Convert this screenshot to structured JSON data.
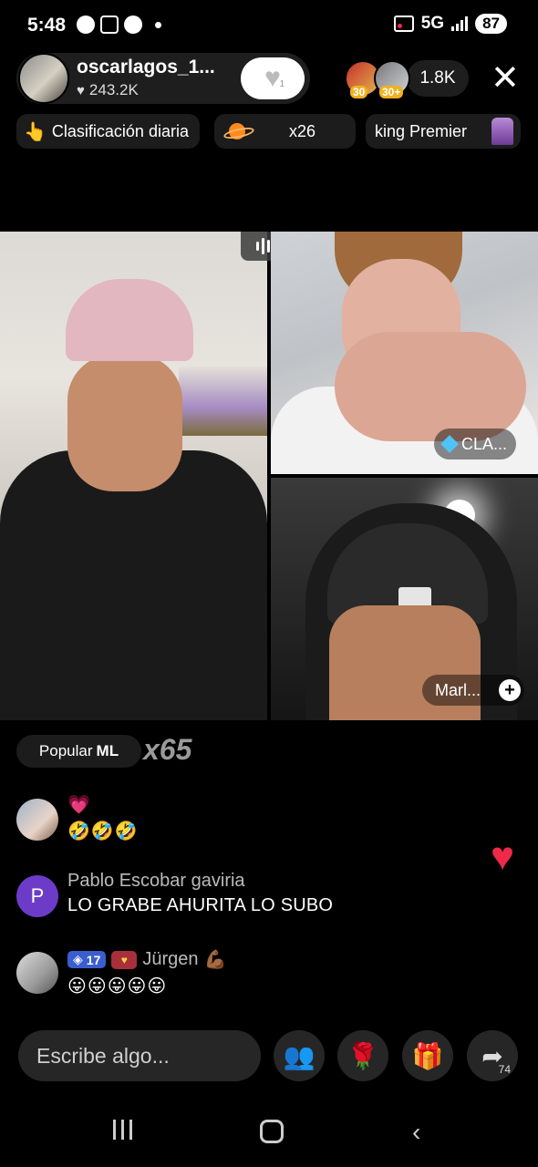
{
  "status_bar": {
    "time": "5:48",
    "network": "5G",
    "battery": "87"
  },
  "host": {
    "name": "oscarlagos_1...",
    "likes": "243.2K",
    "like_count": "1"
  },
  "viewers": {
    "levels": [
      "30",
      "30+"
    ],
    "count": "1.8K"
  },
  "pills": {
    "daily_ranking": "Clasificación diaria",
    "gift_count": "x26",
    "king": "king Premier"
  },
  "guests": {
    "guest1_name": "CLA...",
    "guest2_name": "Marl..."
  },
  "popular": {
    "label": "Popular",
    "region": "ML",
    "multiplier": "x65"
  },
  "comments": [
    {
      "author": "",
      "text": "🤣🤣🤣",
      "top_emoji": "💗"
    },
    {
      "author": "Pablo Escobar gaviria",
      "initial": "P",
      "text": "LO GRABE AHURITA LO SUBO"
    },
    {
      "author": "Jürgen",
      "level": "17",
      "author_emoji": "💪🏾",
      "text": "😛😛😛😛😛"
    }
  ],
  "composer": {
    "placeholder": "Escribe algo..."
  },
  "actions": {
    "share_count": "74"
  },
  "colors": {
    "background": "#000000",
    "like_heart": "#ee2a48",
    "comment_author": "#bbbbbb"
  }
}
